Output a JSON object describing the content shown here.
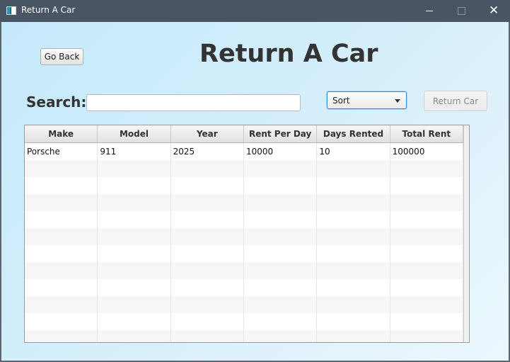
{
  "window": {
    "title": "Return A Car",
    "controls": {
      "minimize": "—",
      "maximize": "☐",
      "close": "✕"
    }
  },
  "header": {
    "go_back_label": "Go Back",
    "page_title": "Return A Car"
  },
  "search": {
    "label": "Search:",
    "value": "",
    "placeholder": ""
  },
  "sort": {
    "selected": "Sort"
  },
  "return_button": {
    "label": "Return Car",
    "enabled": false
  },
  "table": {
    "columns": [
      "Make",
      "Model",
      "Year",
      "Rent Per Day",
      "Days Rented",
      "Total Rent"
    ],
    "rows": [
      [
        "Porsche",
        "911",
        "2025",
        "10000",
        "10",
        "100000"
      ]
    ]
  },
  "colors": {
    "titlebar": "#4a5563",
    "focus_accent": "#2f8fd8",
    "background_gradient_start": "#c4e9fb",
    "background_gradient_end": "#ecf7fd"
  }
}
